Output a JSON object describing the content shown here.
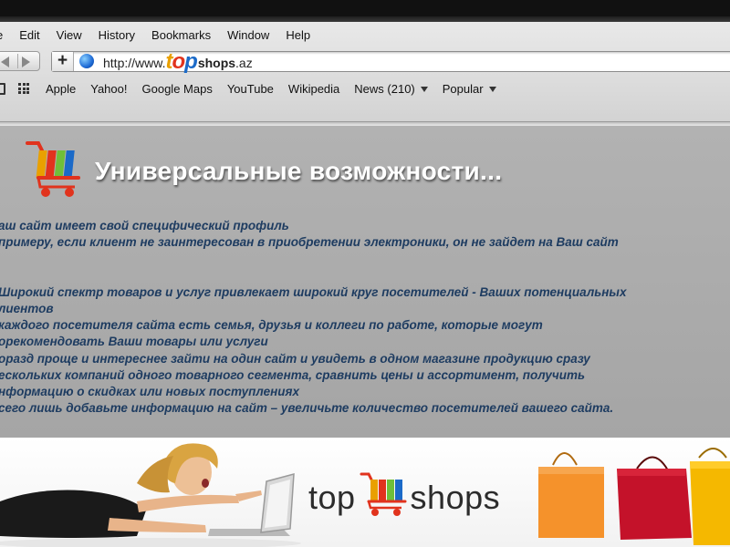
{
  "browser": {
    "menu": [
      "e",
      "Edit",
      "View",
      "History",
      "Bookmarks",
      "Window",
      "Help"
    ],
    "url": {
      "prefix": "http://www.",
      "brand_t": "t",
      "brand_o": "o",
      "brand_p": "p",
      "shops": "shops",
      "tld": ".az"
    },
    "bookmarks": [
      "Apple",
      "Yahoo!",
      "Google Maps",
      "YouTube",
      "Wikipedia",
      "News (210)",
      "Popular"
    ]
  },
  "slide": {
    "headline": "Универсальные возможности...",
    "lines": [
      "аш сайт имеет свой специфический профиль",
      "примеру, если клиент не заинтересован в приобретении электроники, он не зайдет на Ваш сайт",
      "Широкий спектр товаров и услуг привлекает широкий круг посетителей - Ваших потенциальных",
      "лиентов",
      " каждого посетителя сайта есть семья, друзья и коллеги по работе, которые могут",
      "орекомендовать Ваши товары или услуги",
      "оразд проще и интереснее зайти на один сайт и увидеть в одном магазине продукцию сразу",
      "ескольких компаний одного товарного сегмента, сравнить цены и ассортимент, получить",
      "нформацию о скидках или новых поступлениях",
      "сего лишь добавьте информацию на сайт – увеличьте количество посетителей вашего сайта."
    ]
  },
  "banner": {
    "logo_top": "top",
    "logo_shops": "shops"
  },
  "colors": {
    "panel": "#aaaaaa",
    "text": "#1e3c61",
    "brand_orange": "#e9a000",
    "brand_red": "#e1331d",
    "brand_blue": "#1b6ac8"
  },
  "icons": [
    "back-arrow-icon",
    "forward-arrow-icon",
    "plus-icon",
    "globe-icon",
    "bookmarks-book-icon",
    "top-sites-grid-icon",
    "dropdown-caret-icon",
    "shopping-cart-icon"
  ]
}
